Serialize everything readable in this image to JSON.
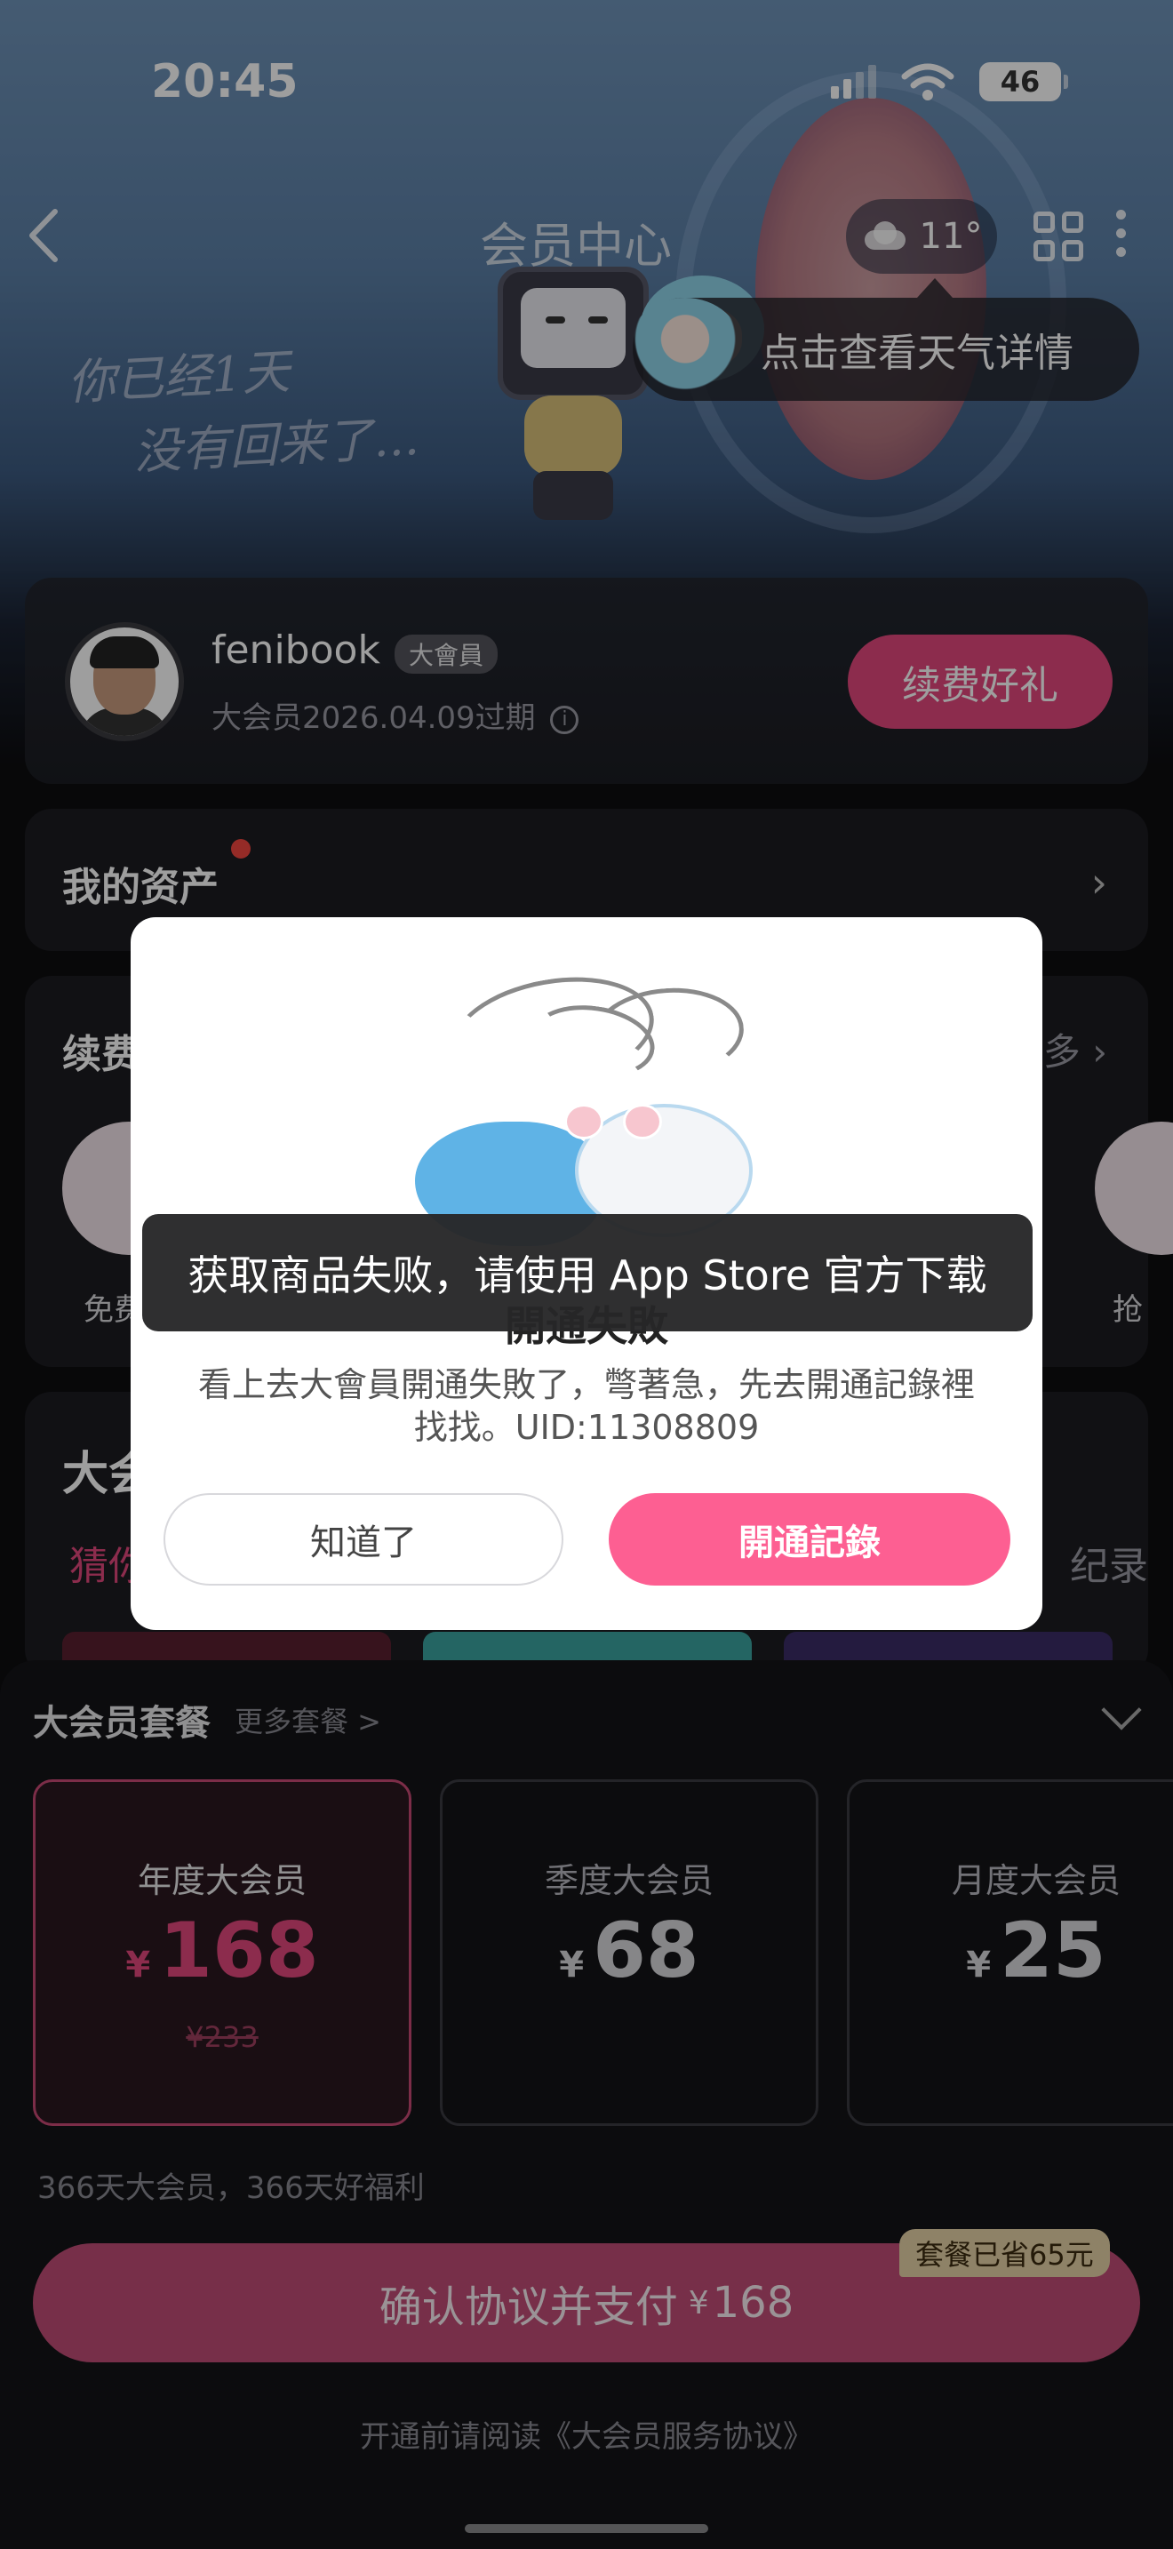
{
  "status_bar": {
    "time": "20:45",
    "battery": "46"
  },
  "nav": {
    "back_icon": "chevron-left-icon",
    "title": "会员中心",
    "weather_temp": "11°",
    "weather_tip": "点击查看天气详情"
  },
  "banner": {
    "graffiti_line1": "你已经1天",
    "graffiti_line2": "没有回来了..."
  },
  "profile": {
    "username": "fenibook",
    "vip_tag": "大會員",
    "expire_text": "大会员2026.04.09过期",
    "info_icon": "i",
    "renew_button": "续费好礼"
  },
  "assets": {
    "title": "我的资产",
    "chevron": "›"
  },
  "benefits": {
    "title": "续费",
    "more": "多 ›",
    "left_label": "免费",
    "right_label": "抢"
  },
  "vip_section": {
    "title": "大会",
    "guess": "猜你",
    "record": "纪录"
  },
  "sheet": {
    "title": "大会员套餐",
    "more": "更多套餐 >",
    "plans": [
      {
        "name": "年度大会员",
        "currency": "¥",
        "price": "168",
        "original": "¥233",
        "selected": true
      },
      {
        "name": "季度大会员",
        "currency": "¥",
        "price": "68",
        "original": "",
        "selected": false
      },
      {
        "name": "月度大会员",
        "currency": "¥",
        "price": "25",
        "original": "",
        "selected": false
      }
    ],
    "plan_desc": "366天大会员，366天好福利",
    "pay_label": "确认协议并支付",
    "pay_currency": "¥",
    "pay_amount": "168",
    "saved_badge": "套餐已省65元",
    "agreement": "开通前请阅读《大会员服务协议》"
  },
  "modal": {
    "title": "開通失敗",
    "body": "看上去大會員開通失敗了，彆著急，先去開通記錄裡找找。UID:11308809",
    "ok_button": "知道了",
    "records_button": "開通記錄"
  },
  "toast": {
    "text": "获取商品失败，请使用 App Store 官方下载"
  },
  "colors": {
    "accent": "#e3487d",
    "modal_primary": "#fd5f92",
    "badge_gold": "#e6d2a6"
  }
}
